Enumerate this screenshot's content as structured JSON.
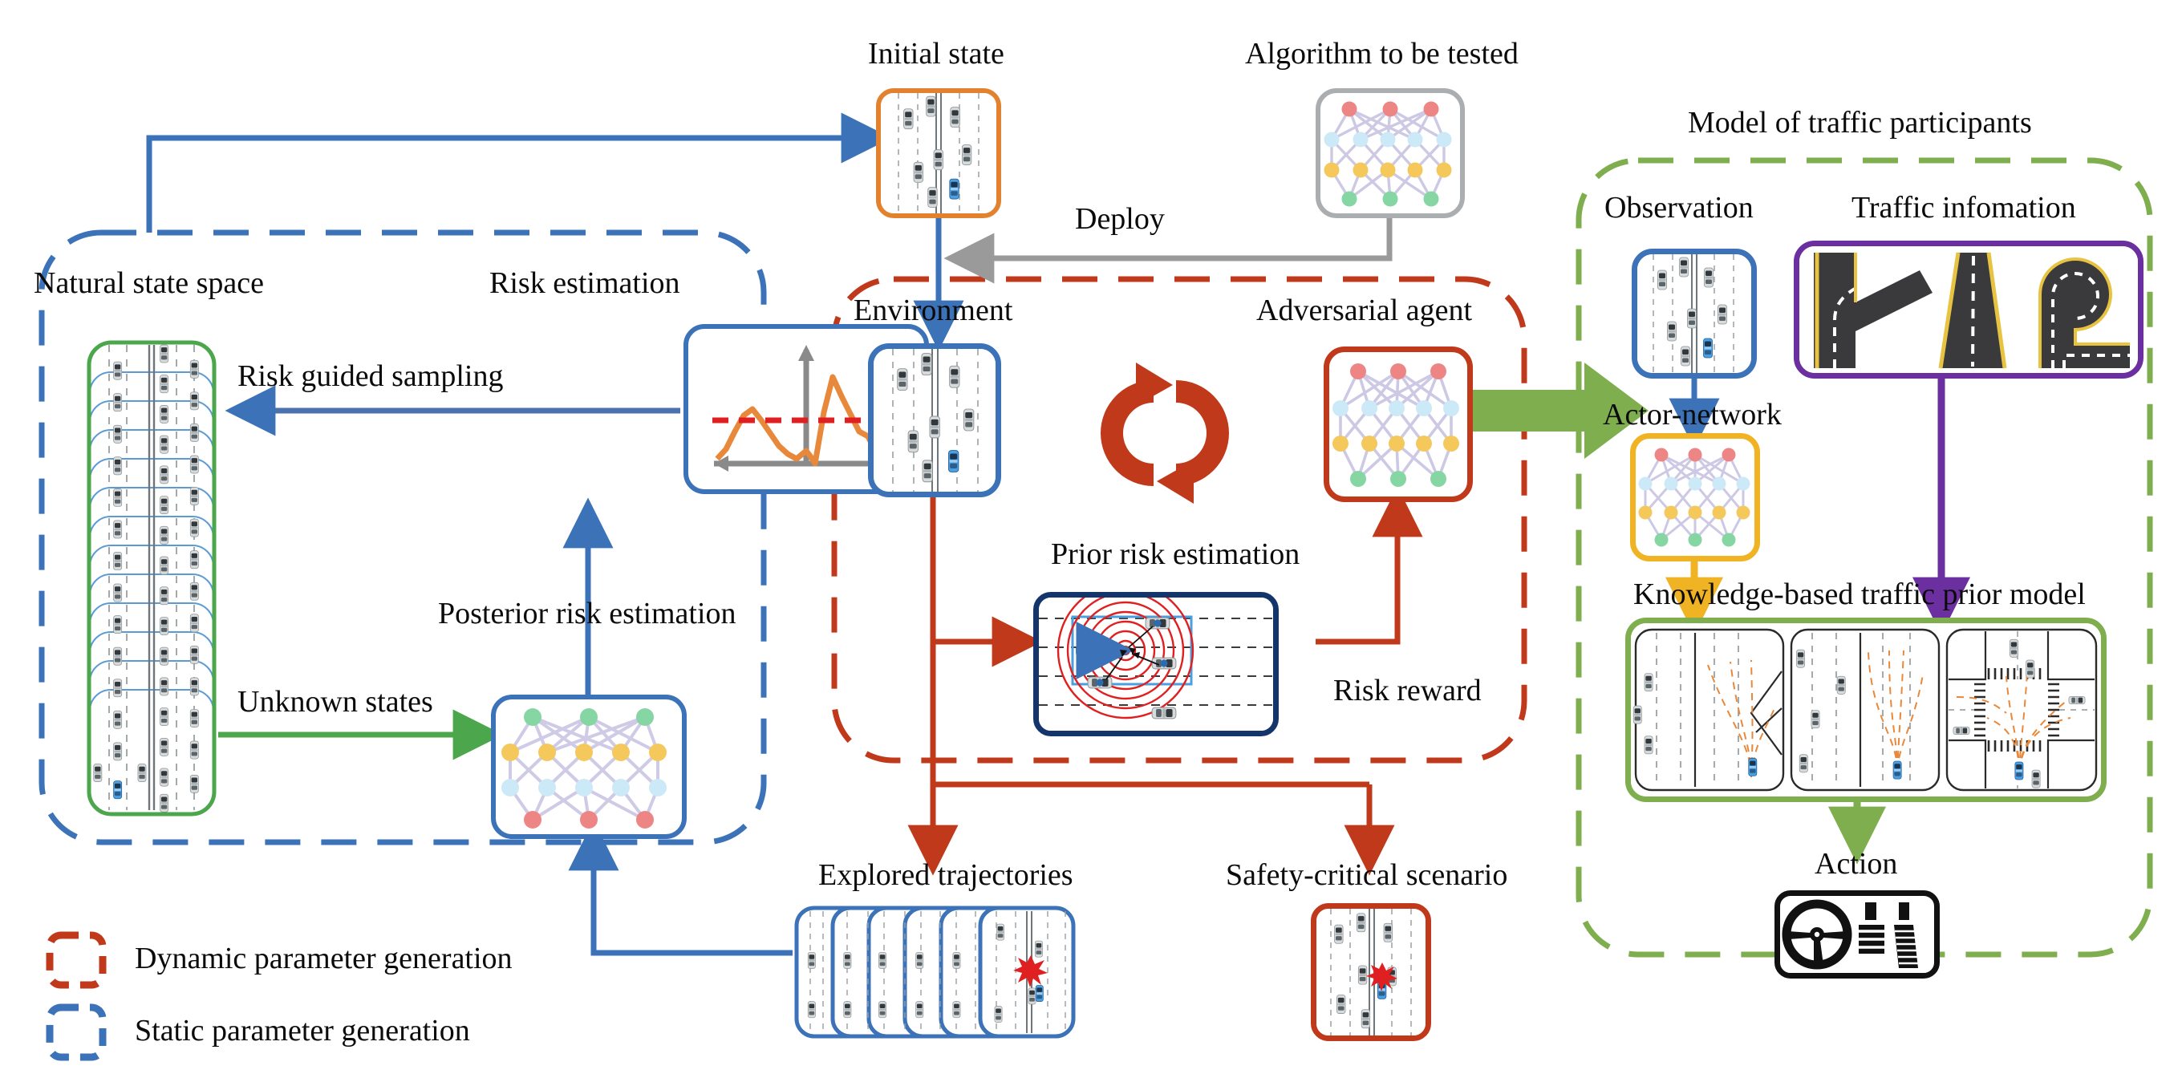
{
  "diagram": {
    "title_visible": false,
    "colors": {
      "blue": "#3B72B8",
      "dark_blue": "#14356B",
      "orange": "#E3822E",
      "red": "#C0391B",
      "green": "#4CA64C",
      "light_green": "#7FAE4F",
      "purple": "#6B2FA0",
      "yellow": "#F0B323",
      "gray": "#9A9A9A",
      "trace_orange": "#E8883A",
      "threshold_red": "#E02020"
    }
  },
  "labels": {
    "natural_state_space": "Natural state space",
    "risk_estimation": "Risk estimation",
    "risk_guided_sampling": "Risk guided sampling",
    "posterior_risk_estimation": "Posterior risk estimation",
    "unknown_states": "Unknown states",
    "initial_state": "Initial state",
    "algorithm_to_be_tested": "Algorithm to be tested",
    "deploy": "Deploy",
    "environment": "Environment",
    "adversarial_agent": "Adversarial agent",
    "prior_risk_estimation": "Prior risk estimation",
    "risk_reward": "Risk reward",
    "explored_trajectories": "Explored trajectories",
    "safety_critical_scenario": "Safety-critical scenario",
    "model_of_traffic_participants": "Model of traffic participants",
    "observation": "Observation",
    "traffic_information": "Traffic infomation",
    "actor_network": "Actor-network",
    "knowledge_based_traffic_prior_model": "Knowledge-based traffic prior model",
    "action": "Action"
  },
  "legend": {
    "items": [
      {
        "label": "Dynamic parameter generation",
        "color": "#C0391B"
      },
      {
        "label": "Static parameter generation",
        "color": "#3B72B8"
      }
    ]
  },
  "chart_data": {
    "type": "line",
    "title": "Risk estimation",
    "xlabel": "",
    "ylabel": "",
    "grid": false,
    "legend": "none",
    "threshold": 0.5,
    "threshold_color": "#E02020",
    "series": [
      {
        "name": "risk",
        "color": "#E8883A",
        "x": [
          0.0,
          0.05,
          0.1,
          0.15,
          0.2,
          0.25,
          0.3,
          0.35,
          0.4,
          0.45,
          0.5,
          0.55,
          0.6,
          0.65,
          0.7,
          0.75,
          0.8,
          0.85,
          0.9,
          0.95,
          1.0
        ],
        "y": [
          0.05,
          0.18,
          0.42,
          0.62,
          0.7,
          0.6,
          0.48,
          0.36,
          0.28,
          0.22,
          0.3,
          0.2,
          0.12,
          0.55,
          0.88,
          0.72,
          0.55,
          0.4,
          0.36,
          0.18,
          0.62
        ]
      }
    ],
    "xlim": [
      0,
      1
    ],
    "ylim": [
      0,
      1
    ]
  },
  "neural_networks": {
    "algorithm": {
      "layer_colors": [
        "#EE7A7A",
        "#BFE3F5",
        "#F5C councils"
      ],
      "nodes": [
        3,
        5,
        5,
        3
      ]
    },
    "adversarial": {
      "nodes": [
        3,
        5,
        5,
        3
      ]
    },
    "posterior": {
      "nodes": [
        3,
        5,
        5,
        3
      ]
    },
    "actor": {
      "nodes": [
        3,
        5,
        5,
        3
      ]
    }
  },
  "prior_risk_scene": {
    "ego_color": "#4A9FE0",
    "risk_center_color": "#E02020",
    "rings": 7,
    "other_vehicles": 4
  },
  "knowledge_scenes": [
    {
      "name": "merge-ramp-scene"
    },
    {
      "name": "straight-highway-scene"
    },
    {
      "name": "intersection-scene"
    }
  ],
  "traffic_information_shapes": [
    {
      "name": "fork-road"
    },
    {
      "name": "straight-road"
    },
    {
      "name": "loop-road"
    }
  ],
  "action_controls": [
    {
      "name": "steering-wheel"
    },
    {
      "name": "brake-pedal"
    },
    {
      "name": "accelerator-pedal"
    }
  ]
}
